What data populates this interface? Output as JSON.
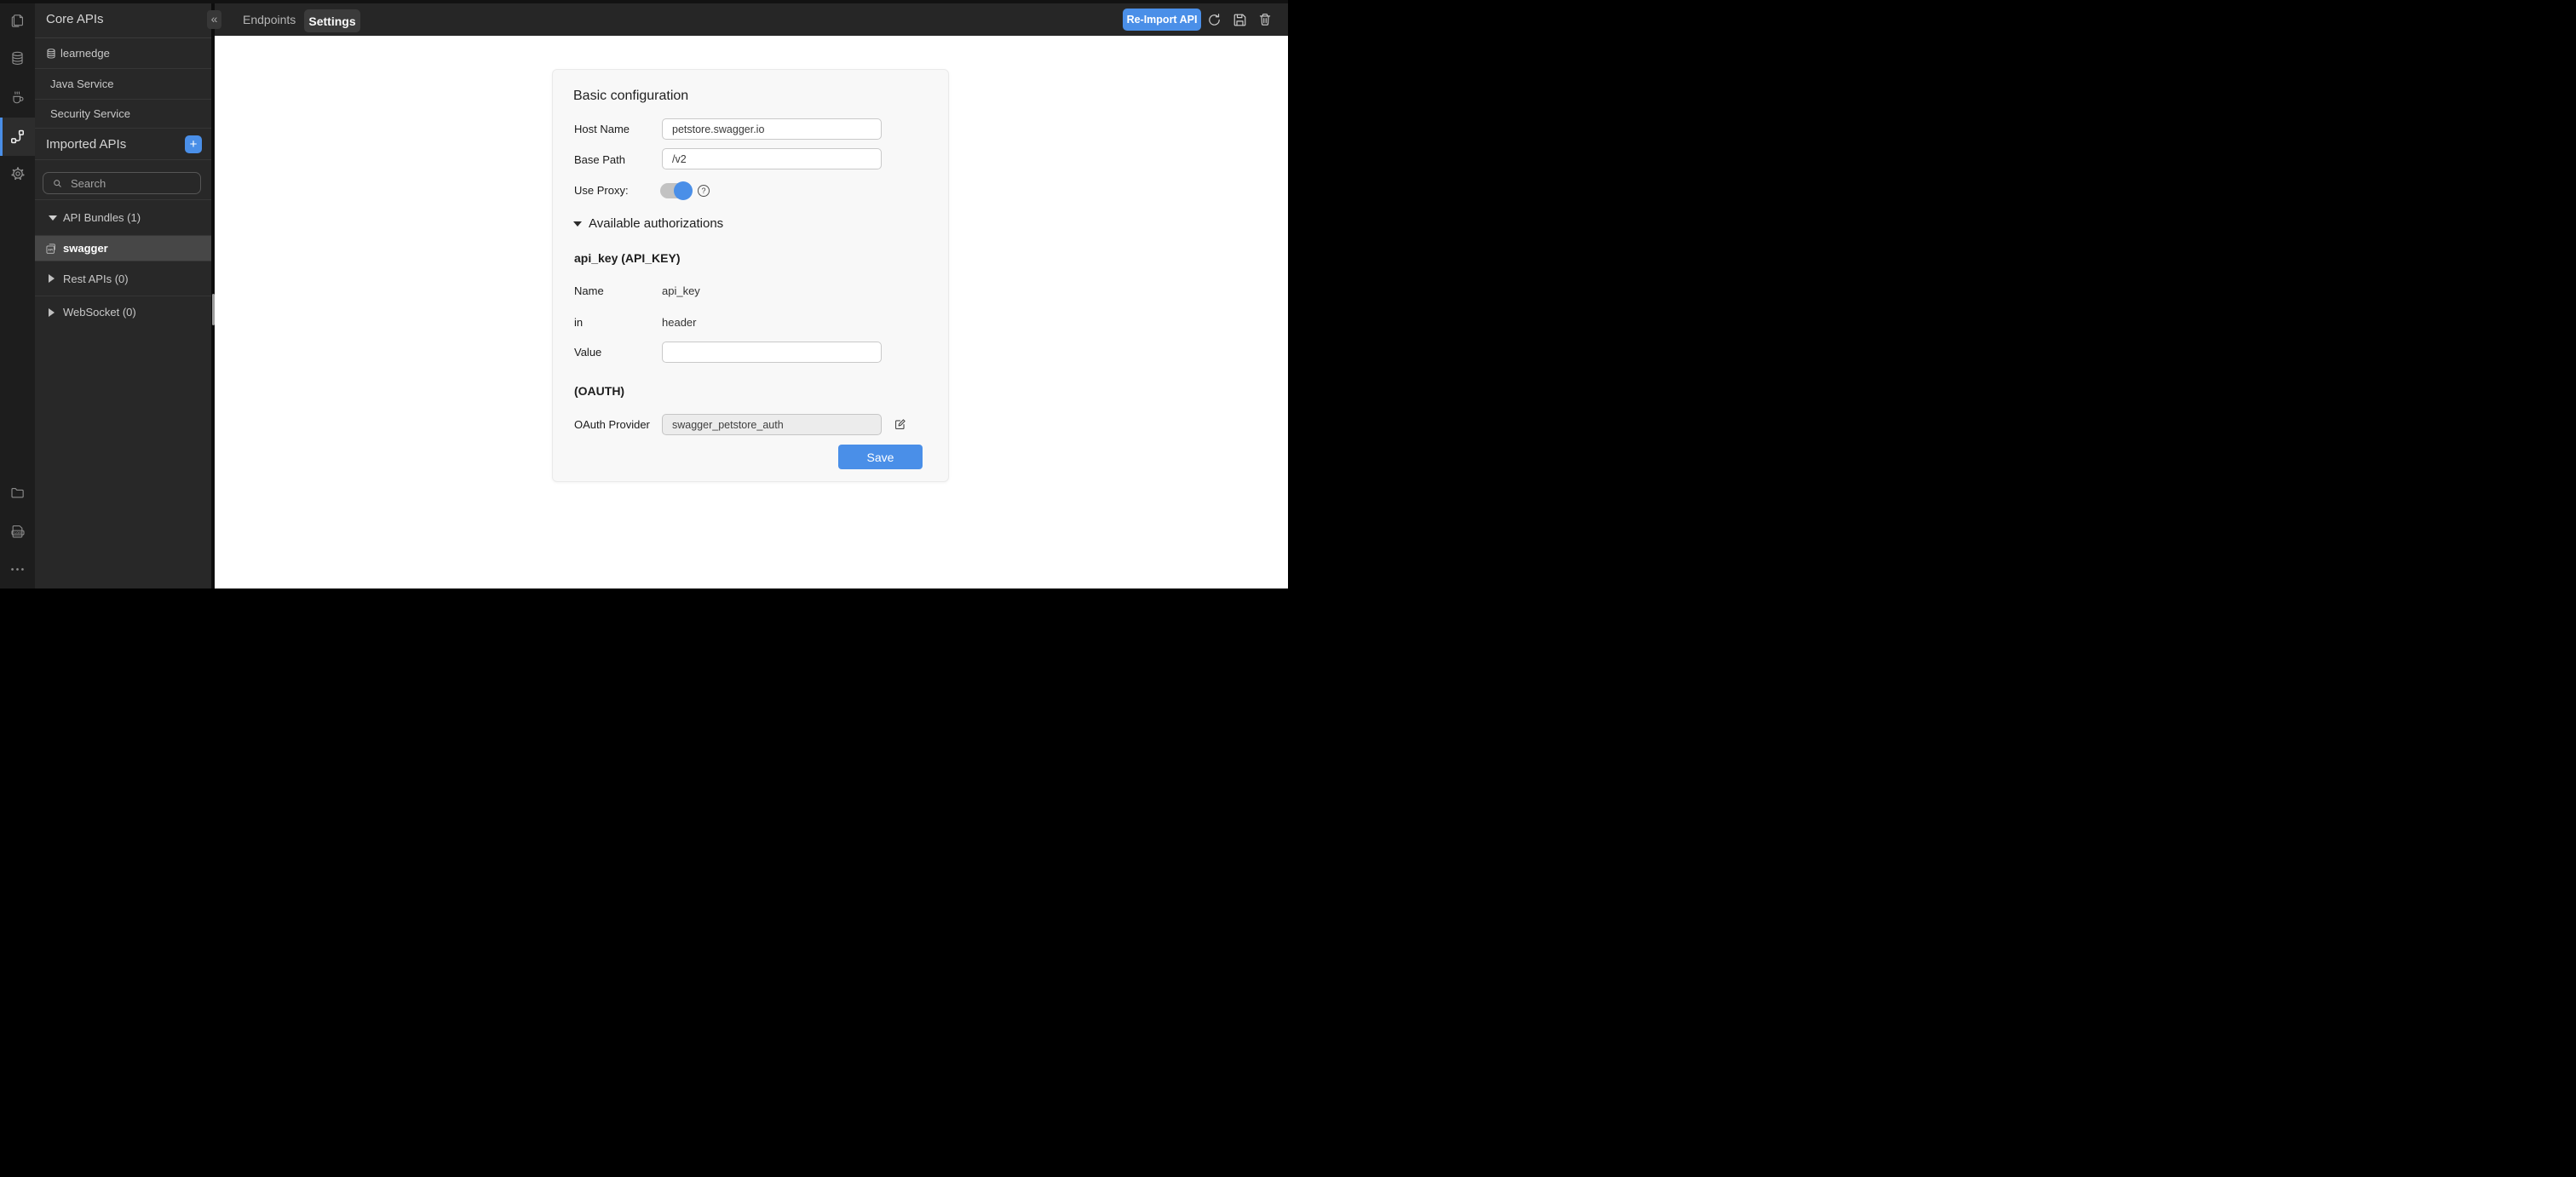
{
  "colors": {
    "accent": "#4a8fe8",
    "rail_bg": "#1d1d1d",
    "sidebar_bg": "#282828",
    "topbar_bg": "#262626",
    "selected_row_bg": "#474747",
    "card_bg": "#f8f8f8"
  },
  "icons": {
    "collapse": "«",
    "add": "+",
    "help": "?"
  },
  "sidebar": {
    "title": "Core APIs",
    "services": [
      {
        "label": "learnedge"
      },
      {
        "label": "Java Service"
      },
      {
        "label": "Security Service"
      }
    ],
    "imported_title": "Imported APIs",
    "search_placeholder": "Search",
    "tree": {
      "bundles_label": "API Bundles (1)",
      "bundle_name": "swagger",
      "rest_label": "Rest APIs (0)",
      "websocket_label": "WebSocket (0)"
    }
  },
  "topbar": {
    "endpoints_tab": "Endpoints",
    "settings_tab": "Settings",
    "reimport_button": "Re-Import API"
  },
  "form": {
    "heading": "Basic configuration",
    "host_label": "Host Name",
    "host_value": "petstore.swagger.io",
    "base_label": "Base Path",
    "base_value": "/v2",
    "proxy_label": "Use Proxy:",
    "proxy_on": true,
    "auth_title": "Available authorizations",
    "api_key_heading": "api_key (API_KEY)",
    "name_label": "Name",
    "name_value": "api_key",
    "in_label": "in",
    "in_value": "header",
    "value_label": "Value",
    "value_value": "",
    "oauth_heading": "(OAUTH)",
    "provider_label": "OAuth Provider",
    "provider_value": "swagger_petstore_auth",
    "save_button": "Save"
  }
}
